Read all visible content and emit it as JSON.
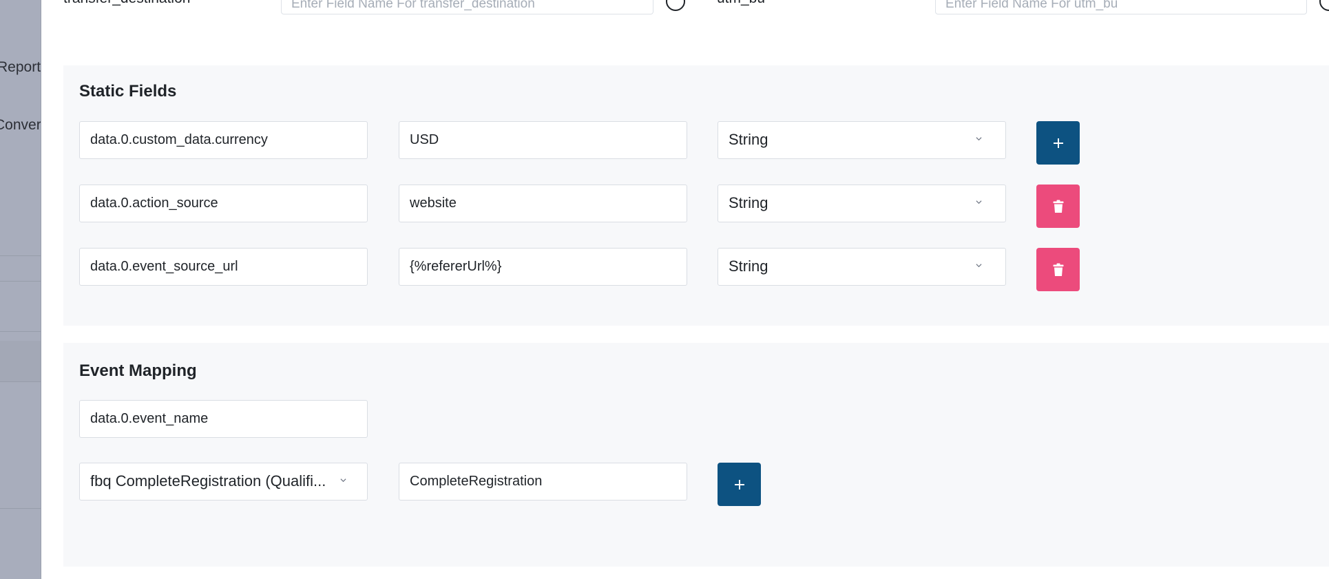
{
  "sidebar": {
    "items": [
      {
        "label": "Report"
      },
      {
        "label": "Conver"
      }
    ]
  },
  "top_row": {
    "left_label": "transfer_destination",
    "left_placeholder": "Enter Field Name For transfer_destination",
    "right_label": "utm_bu",
    "right_placeholder": "Enter Field Name For utm_bu"
  },
  "static_fields": {
    "title": "Static Fields",
    "rows": [
      {
        "key": "data.0.custom_data.currency",
        "value": "USD",
        "type": "String",
        "action": "add"
      },
      {
        "key": "data.0.action_source",
        "value": "website",
        "type": "String",
        "action": "delete"
      },
      {
        "key": "data.0.event_source_url",
        "value": "{%refererUrl%}",
        "type": "String",
        "action": "delete"
      }
    ]
  },
  "event_mapping": {
    "title": "Event Mapping",
    "field": "data.0.event_name",
    "event_select": "fbq CompleteRegistration (Qualifi...",
    "event_value": "CompleteRegistration"
  },
  "colors": {
    "add_button": "#0d5281",
    "delete_button": "#ec4b7c",
    "card_background": "#f7f8fa",
    "sidebar_background": "#a8adbc"
  },
  "icons": {
    "add": "plus-icon",
    "delete": "trash-icon",
    "dropdown": "chevron-down-icon",
    "info": "info-circle-icon"
  }
}
